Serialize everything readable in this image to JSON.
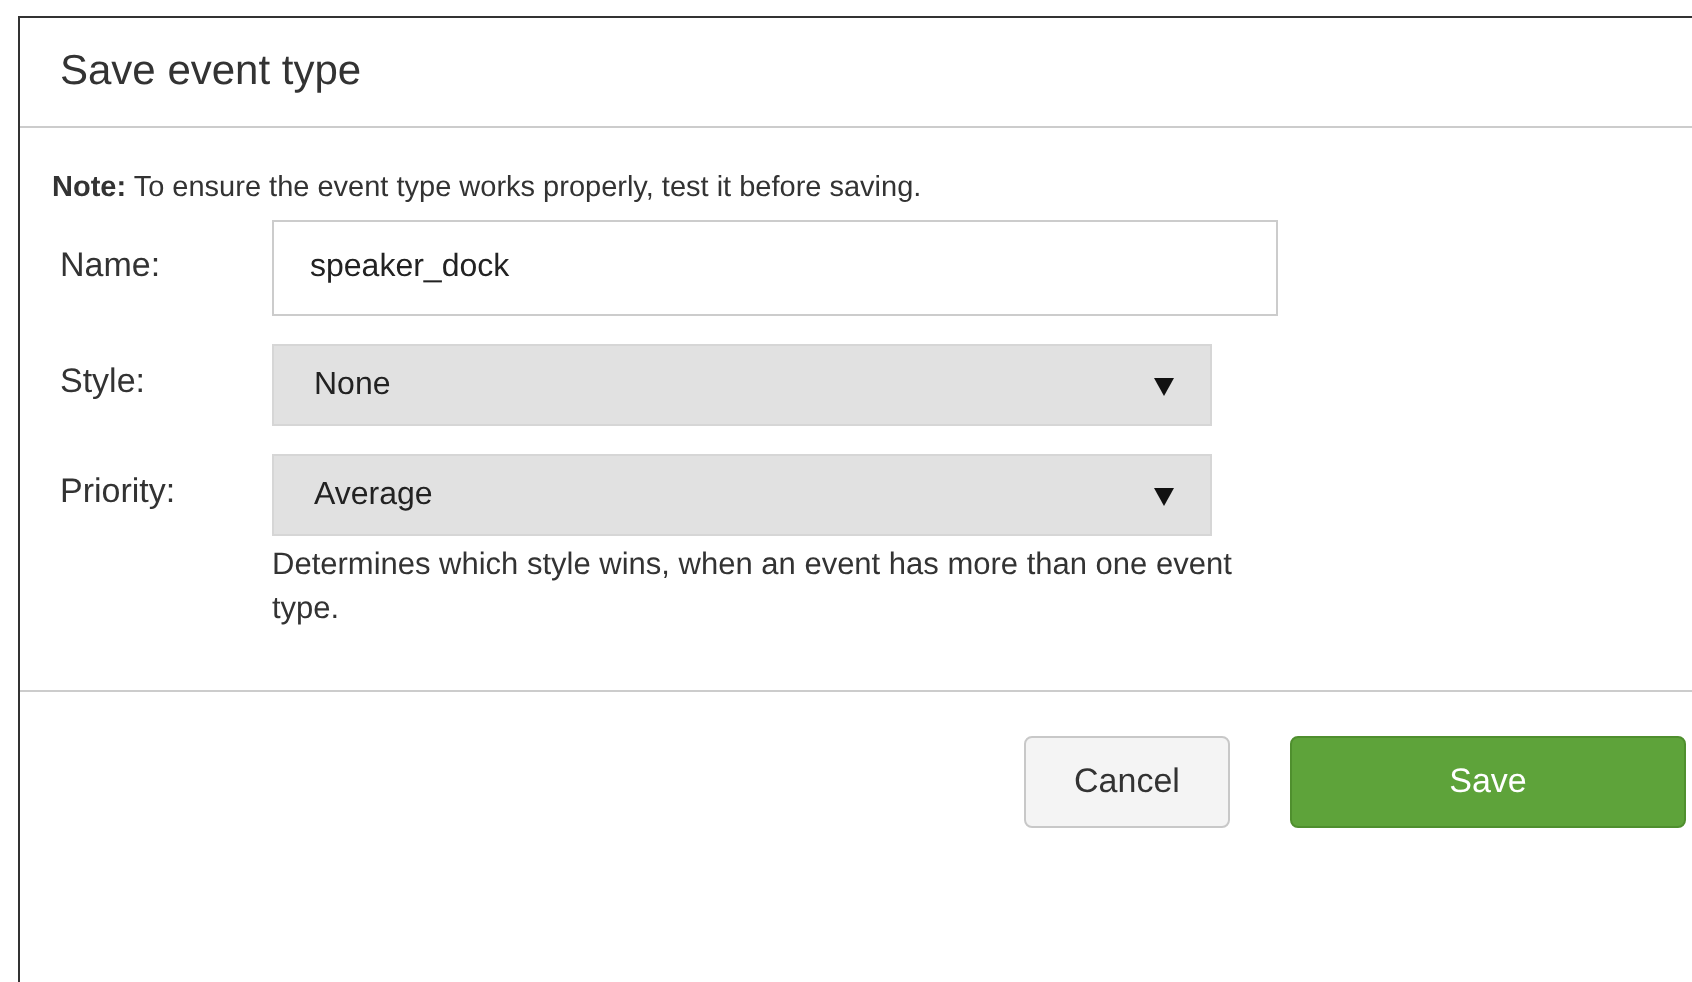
{
  "dialog": {
    "title": "Save event type",
    "note": "**Note:** To ensure the event type works properly, test it before saving.",
    "fields": [
      {
        "kind": "text",
        "label": "Name:",
        "value": "speaker_dock"
      },
      {
        "kind": "select",
        "label": "Style:",
        "value": "None"
      },
      {
        "kind": "select",
        "label": "Priority:",
        "value": "Average",
        "help": "Determines which style wins, when an event has more than one event type."
      }
    ],
    "buttons": [
      {
        "kind": "secondary",
        "label": "Cancel"
      },
      {
        "kind": "primary",
        "label": "Save"
      }
    ]
  }
}
